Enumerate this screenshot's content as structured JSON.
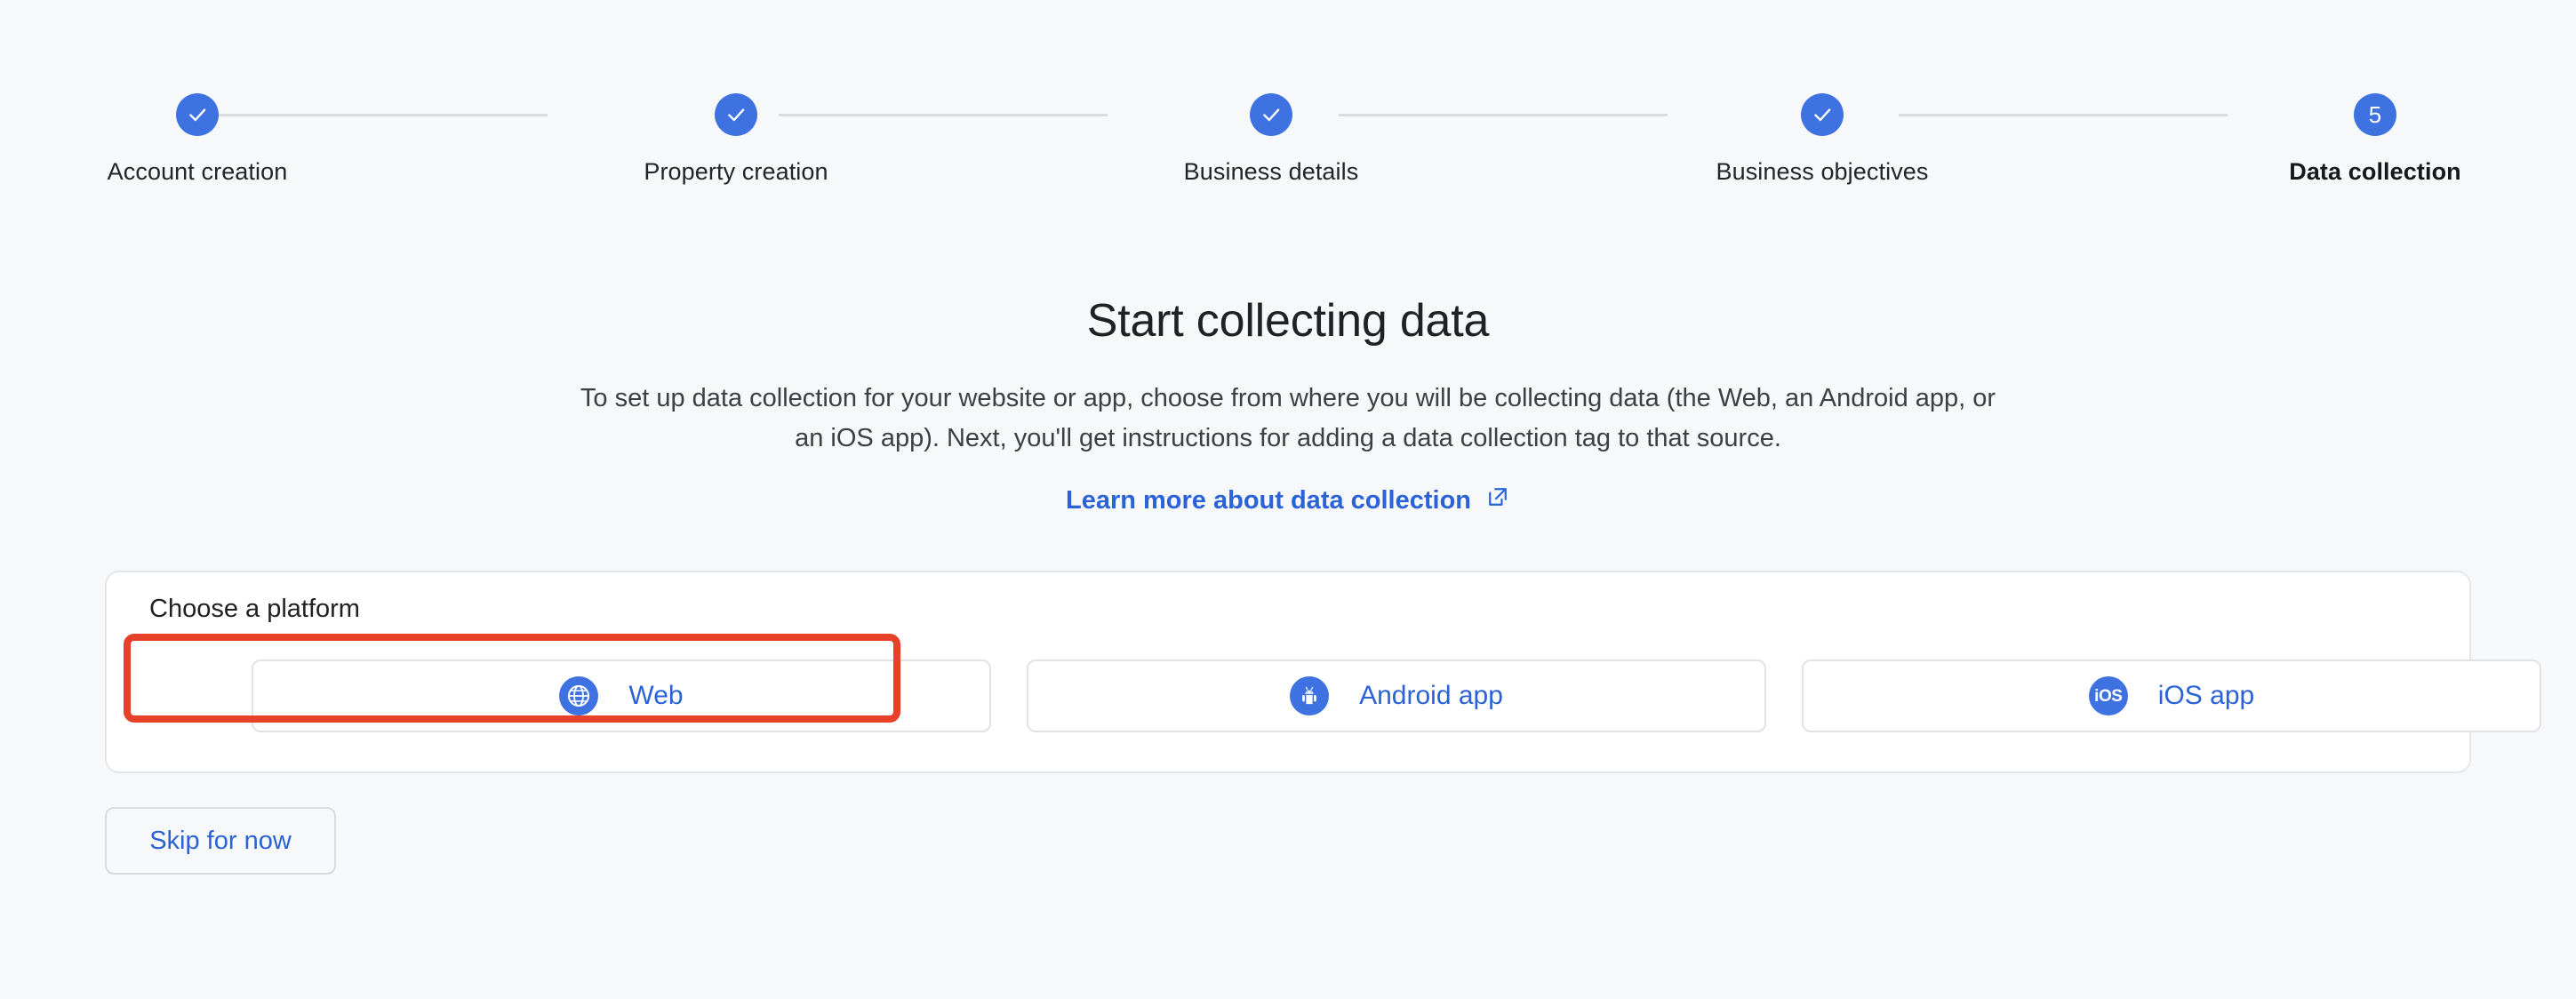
{
  "stepper": {
    "steps": [
      {
        "label": "Account creation",
        "state": "complete",
        "icon": "check-icon",
        "number": "1"
      },
      {
        "label": "Property creation",
        "state": "complete",
        "icon": "check-icon",
        "number": "2"
      },
      {
        "label": "Business details",
        "state": "complete",
        "icon": "check-icon",
        "number": "3"
      },
      {
        "label": "Business objectives",
        "state": "complete",
        "icon": "check-icon",
        "number": "4"
      },
      {
        "label": "Data collection",
        "state": "current",
        "icon": "number",
        "number": "5"
      }
    ],
    "accent_color": "#3d72e0",
    "connector_color": "#dadce0"
  },
  "hero": {
    "title": "Start collecting data",
    "description": "To set up data collection for your website or app, choose from where you will be collecting data (the Web, an Android app, or an iOS app). Next, you'll get instructions for adding a data collection tag to that source.",
    "link_text": "Learn more about data collection",
    "link_icon": "external-link-icon",
    "link_color": "#2a63d6"
  },
  "platform_card": {
    "label": "Choose a platform",
    "options": [
      {
        "label": "Web",
        "icon": "globe-icon",
        "selected": true
      },
      {
        "label": "Android app",
        "icon": "android-icon",
        "selected": false
      },
      {
        "label": "iOS app",
        "icon": "ios-icon",
        "selected": false
      }
    ],
    "ios_icon_text": "iOS"
  },
  "footer": {
    "skip_label": "Skip for now"
  },
  "annotation": {
    "highlight_color": "#e8412a",
    "highlight_target": "Web"
  }
}
